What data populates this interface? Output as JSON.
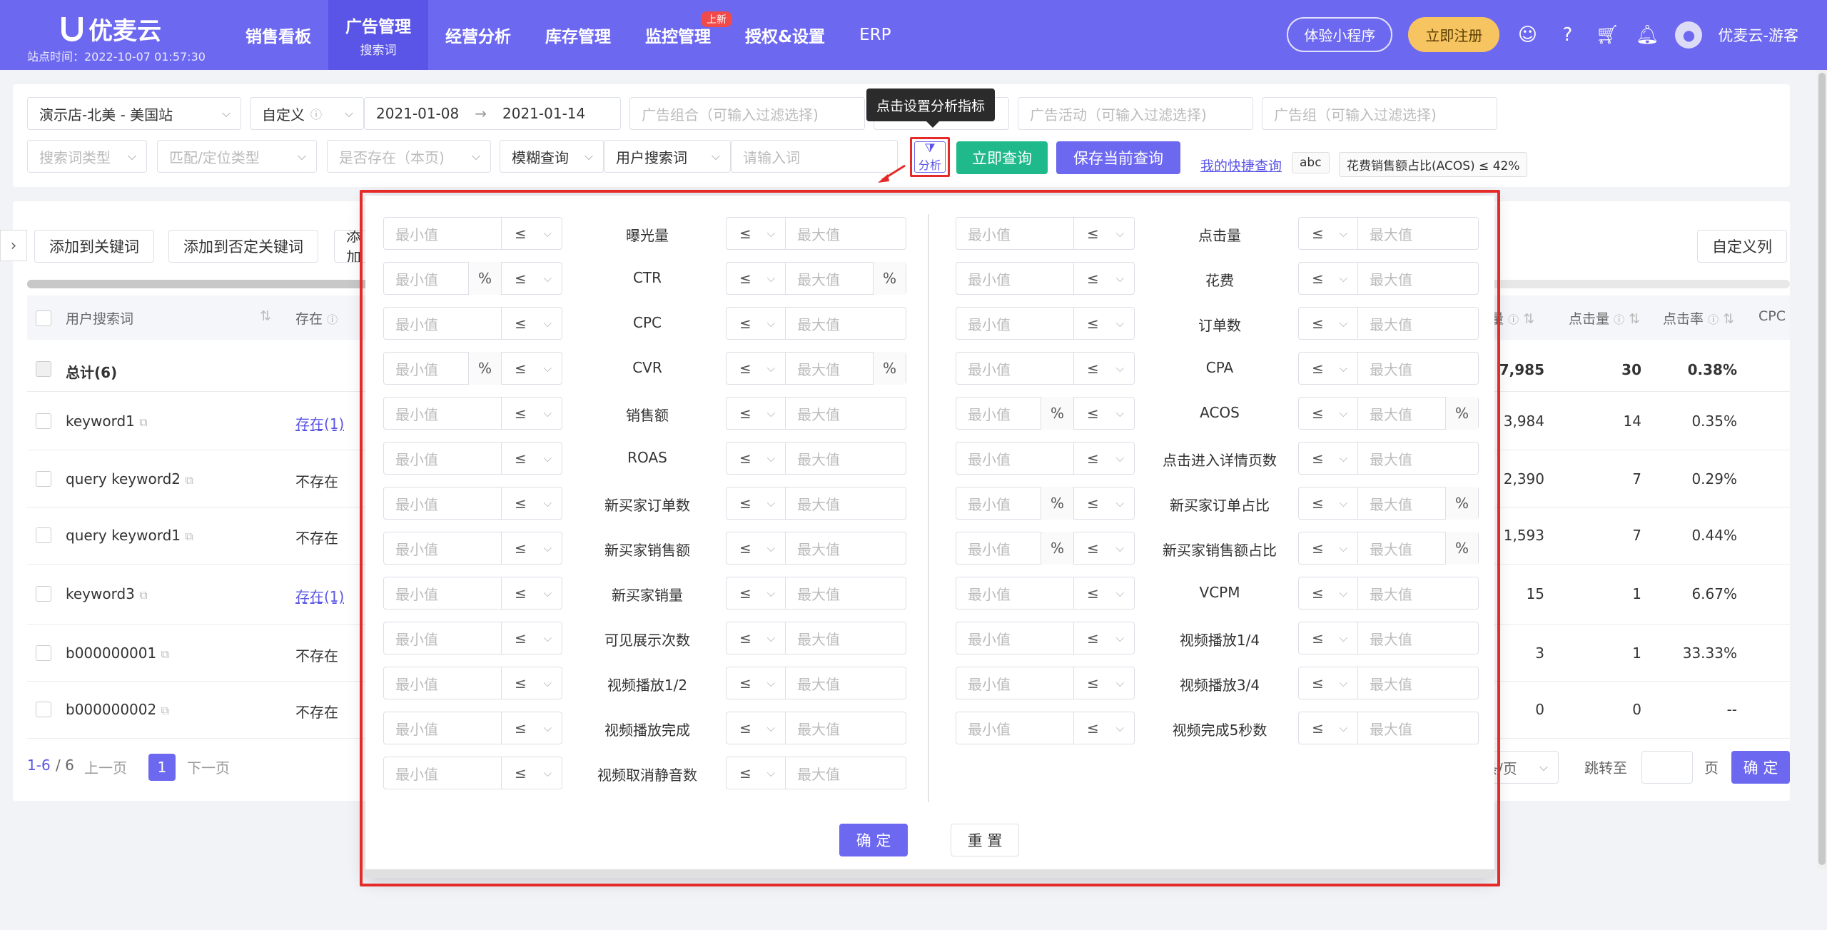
{
  "nav": {
    "logo": "优麦云",
    "site_time": "站点时间：2022-10-07 01:57:30",
    "items": [
      {
        "label": "销售看板",
        "sub": ""
      },
      {
        "label": "广告管理",
        "sub": "搜索词"
      },
      {
        "label": "经营分析",
        "sub": ""
      },
      {
        "label": "库存管理",
        "sub": ""
      },
      {
        "label": "监控管理",
        "sub": ""
      },
      {
        "label": "授权&设置",
        "sub": ""
      },
      {
        "label": "ERP",
        "sub": ""
      }
    ],
    "new_badge": "上新",
    "mini_program": "体验小程序",
    "register": "立即注册",
    "user": "优麦云-游客"
  },
  "filters": {
    "store": "演示店-北美 - 美国站",
    "date_mode": "自定义",
    "date_start": "2021-01-08",
    "date_arrow": "→",
    "date_end": "2021-01-14",
    "ad_portfolio_ph": "广告组合（可输入过滤选择)",
    "ad_campaign_ph": "广告活动（可输入过滤选择)",
    "ad_group_ph": "广告组（可输入过滤选择)",
    "search_type_ph": "搜索词类型",
    "match_ph": "匹配/定位类型",
    "exists_ph": "是否存在（本页)",
    "fuzzy": "模糊查询",
    "user_term": "用户搜索词",
    "input_ph": "请输入词",
    "analysis": "分析",
    "tooltip": "点击设置分析指标",
    "query": "立即查询",
    "save_query": "保存当前查询",
    "quick_query": "我的快捷查询",
    "tag1": "abc",
    "tag2": "花费销售额占比(ACOS) ≤ 42%"
  },
  "actions": {
    "add_keyword": "添加到关键词",
    "add_negative": "添加到否定关键词",
    "add_more": "添加",
    "custom_cols": "自定义列"
  },
  "table": {
    "headers": {
      "term": "用户搜索词",
      "exists": "存在",
      "impr": "量",
      "clicks": "点击量",
      "ctr": "点击率",
      "cpc": "CPC"
    },
    "total_label": "总计(6)",
    "total": {
      "impr": "7,985",
      "clicks": "30",
      "ctr": "0.38%"
    },
    "rows": [
      {
        "term": "keyword1",
        "exists": "存在(1)",
        "impr": "3,984",
        "clicks": "14",
        "ctr": "0.35%"
      },
      {
        "term": "query keyword2",
        "exists": "不存在",
        "impr": "2,390",
        "clicks": "7",
        "ctr": "0.29%"
      },
      {
        "term": "query keyword1",
        "exists": "不存在",
        "impr": "1,593",
        "clicks": "7",
        "ctr": "0.44%"
      },
      {
        "term": "keyword3",
        "exists": "存在(1)",
        "impr": "15",
        "clicks": "1",
        "ctr": "6.67%"
      },
      {
        "term": "b000000001",
        "exists": "不存在",
        "impr": "3",
        "clicks": "1",
        "ctr": "33.33%"
      },
      {
        "term": "b000000002",
        "exists": "不存在",
        "impr": "0",
        "clicks": "0",
        "ctr": "--"
      }
    ]
  },
  "pager": {
    "range": "1-6",
    "total": "/ 6",
    "prev": "上一页",
    "page": "1",
    "next": "下一页",
    "per_page": "条/页",
    "jump": "跳转至",
    "page_unit": "页",
    "confirm": "确 定"
  },
  "modal": {
    "min_ph": "最小值",
    "max_ph": "最大值",
    "op": "≤",
    "pct": "%",
    "ok": "确 定",
    "reset": "重 置",
    "left": [
      {
        "label": "曝光量",
        "pct": false
      },
      {
        "label": "CTR",
        "pct": true
      },
      {
        "label": "CPC",
        "pct": false
      },
      {
        "label": "CVR",
        "pct": true
      },
      {
        "label": "销售额",
        "pct": false
      },
      {
        "label": "ROAS",
        "pct": false
      },
      {
        "label": "新买家订单数",
        "pct": false
      },
      {
        "label": "新买家销售额",
        "pct": false
      },
      {
        "label": "新买家销量",
        "pct": false
      },
      {
        "label": "可见展示次数",
        "pct": false
      },
      {
        "label": "视频播放1/2",
        "pct": false
      },
      {
        "label": "视频播放完成",
        "pct": false
      },
      {
        "label": "视频取消静音数",
        "pct": false
      }
    ],
    "right": [
      {
        "label": "点击量",
        "pct": false
      },
      {
        "label": "花费",
        "pct": false
      },
      {
        "label": "订单数",
        "pct": false
      },
      {
        "label": "CPA",
        "pct": false
      },
      {
        "label": "ACOS",
        "pct": true
      },
      {
        "label": "点击进入详情页数",
        "pct": false
      },
      {
        "label": "新买家订单占比",
        "pct": true
      },
      {
        "label": "新买家销售额占比",
        "pct": true
      },
      {
        "label": "VCPM",
        "pct": false
      },
      {
        "label": "视频播放1/4",
        "pct": false
      },
      {
        "label": "视频播放3/4",
        "pct": false
      },
      {
        "label": "视频完成5秒数",
        "pct": false
      }
    ]
  }
}
